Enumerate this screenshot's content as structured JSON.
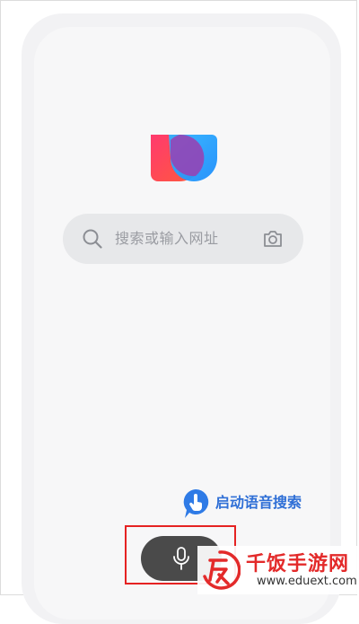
{
  "search": {
    "placeholder": "搜索或输入网址"
  },
  "voice_hint": {
    "label": "启动语音搜索"
  },
  "watermark": {
    "title": "千饭手游网",
    "url": "www.eduext.com"
  },
  "colors": {
    "accent_blue": "#2f6fd6",
    "highlight_red": "#e52222",
    "mic_button": "#4a4a4a"
  },
  "icons": {
    "search": "search-icon",
    "camera": "camera-icon",
    "microphone": "microphone-icon",
    "voice_hint": "hand-pointer-bubble-icon"
  }
}
